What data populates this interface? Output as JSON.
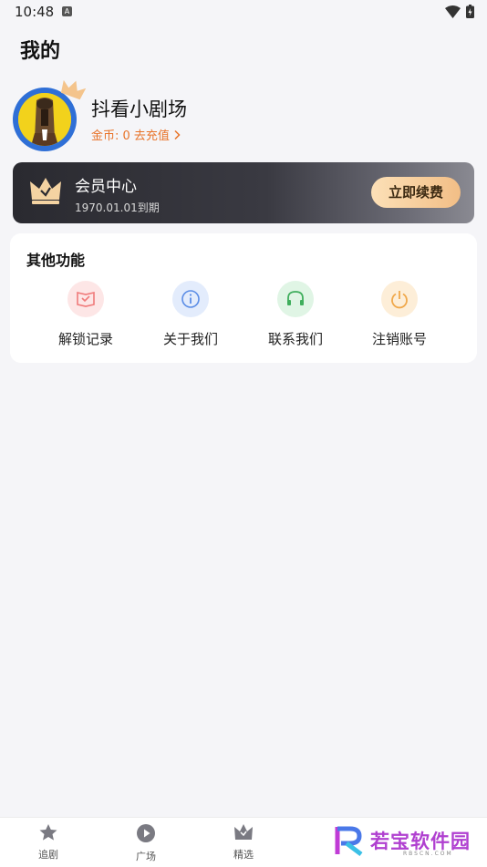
{
  "status": {
    "time": "10:48",
    "indicator": "A"
  },
  "page_title": "我的",
  "profile": {
    "username": "抖看小剧场",
    "coin_text": "金币: 0 去充值"
  },
  "vip": {
    "title": "会员中心",
    "expire": "1970.01.01到期",
    "renew_label": "立即续费"
  },
  "functions": {
    "title": "其他功能",
    "items": [
      {
        "label": "解锁记录",
        "icon": "unlock-record-icon",
        "color": "#f07a7a",
        "bg": "#fde6e6"
      },
      {
        "label": "关于我们",
        "icon": "info-icon",
        "color": "#5b8de6",
        "bg": "#e3ecfc"
      },
      {
        "label": "联系我们",
        "icon": "headset-icon",
        "color": "#3fae5c",
        "bg": "#e0f5e5"
      },
      {
        "label": "注销账号",
        "icon": "power-icon",
        "color": "#f0a84a",
        "bg": "#fdeed8"
      }
    ]
  },
  "tabs": [
    {
      "label": "追剧",
      "icon": "star-icon"
    },
    {
      "label": "广场",
      "icon": "play-icon"
    },
    {
      "label": "精选",
      "icon": "crown-icon"
    }
  ],
  "watermark": {
    "text": "若宝软件园",
    "sub": "RBSCN.COM"
  }
}
